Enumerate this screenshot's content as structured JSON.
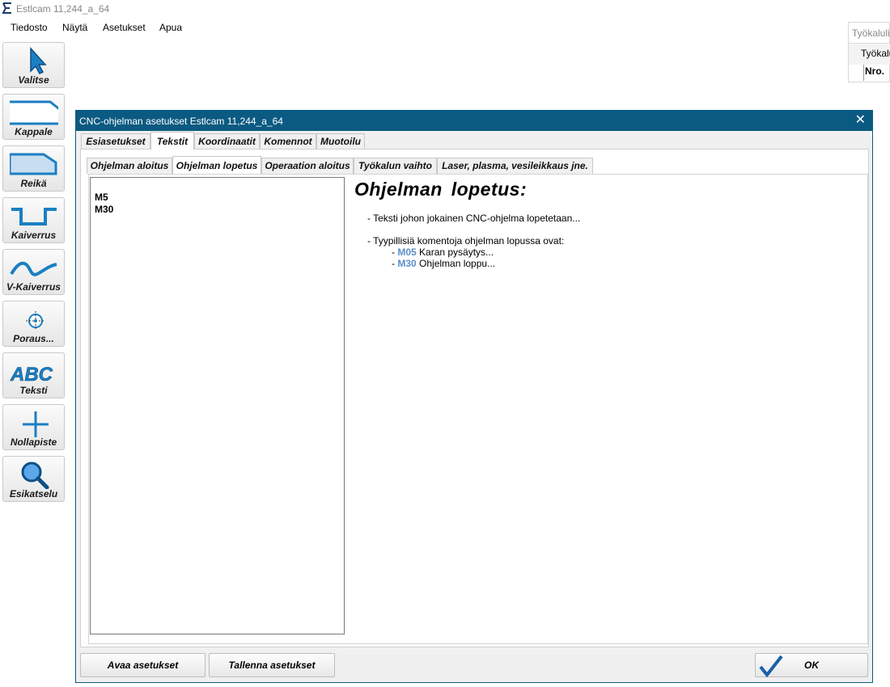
{
  "app": {
    "title": "Estlcam 11,244_a_64"
  },
  "menu": [
    "Tiedosto",
    "Näytä",
    "Asetukset",
    "Apua"
  ],
  "toolbar": [
    {
      "label": "Valitse",
      "icon": "cursor-arrow-icon"
    },
    {
      "label": "Kappale",
      "icon": "part-outline-icon"
    },
    {
      "label": "Reikä",
      "icon": "hole-outline-icon"
    },
    {
      "label": "Kaiverrus",
      "icon": "engrave-groove-icon"
    },
    {
      "label": "V-Kaiverrus",
      "icon": "v-carve-wave-icon"
    },
    {
      "label": "Poraus...",
      "icon": "drill-crosshair-icon"
    },
    {
      "label": "Teksti",
      "icon": "abc-text-icon"
    },
    {
      "label": "Nollapiste",
      "icon": "origin-cross-icon"
    },
    {
      "label": "Esikatselu",
      "icon": "magnifier-icon"
    }
  ],
  "tools_panel": {
    "title": "Työkaluli",
    "tab": "Työkalu",
    "column": "Nro."
  },
  "dialog": {
    "title": "CNC-ohjelman asetukset Estlcam 11,244_a_64",
    "tabs": [
      "Esiasetukset",
      "Tekstit",
      "Koordinaatit",
      "Komennot",
      "Muotoilu"
    ],
    "active_tab": "Tekstit",
    "subtabs": [
      "Ohjelman aloitus",
      "Ohjelman lopetus",
      "Operaation aloitus",
      "Työkalun vaihto",
      "Laser, plasma, vesileikkaus jne."
    ],
    "active_subtab": "Ohjelman lopetus",
    "code_lines": [
      "M5",
      "M30"
    ],
    "help": {
      "title": "Ohjelman  lopetus:",
      "line1": "- Teksti johon jokainen CNC-ohjelma lopetetaan...",
      "line2": "- Tyypillisiä komentoja ohjelman lopussa ovat:",
      "cmd1_dash": "- ",
      "cmd1_code": "M05",
      "cmd1_text": " Karan pysäytys...",
      "cmd2_dash": "- ",
      "cmd2_code": "M30",
      "cmd2_text": " Ohjelman loppu..."
    },
    "buttons": {
      "open": "Avaa asetukset",
      "save": "Tallenna asetukset",
      "ok": "OK"
    }
  },
  "colors": {
    "titlebar": "#0b5a82",
    "accent": "#1a7fc4",
    "keyword": "#5b8fc8"
  }
}
